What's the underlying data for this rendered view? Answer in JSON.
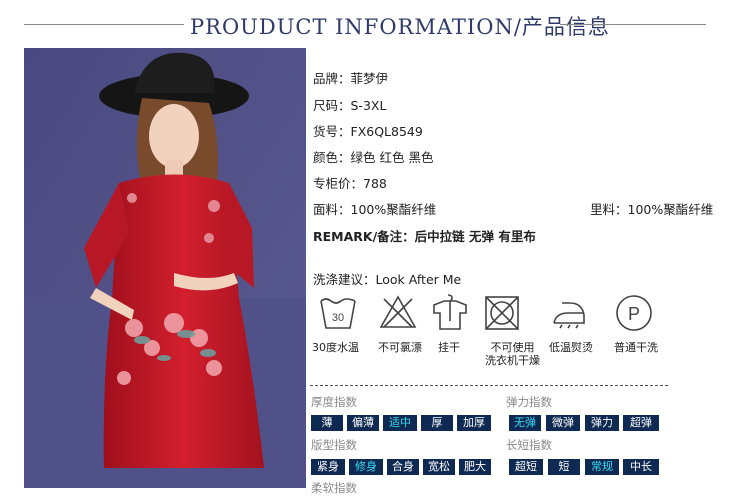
{
  "header": {
    "title": "PROUDUCT  INFORMATION/产品信息"
  },
  "product": {
    "brand": "品牌：菲梦伊",
    "size": "尺码：S-3XL",
    "sku": "货号：FX6QL8549",
    "color": "颜色：绿色  红色  黑色",
    "price": "专柜价：788",
    "fabric": "面料：100%聚酯纤维",
    "lining": "里料：100%聚酯纤维",
    "remark": "REMARK/备注：后中拉链 无弹 有里布"
  },
  "care": {
    "title": "洗涤建议：Look After Me",
    "items": [
      {
        "icon": "wash-30-icon",
        "label": "30度水温"
      },
      {
        "icon": "no-bleach-icon",
        "label": "不可氯漂"
      },
      {
        "icon": "hang-dry-icon",
        "label": "挂干"
      },
      {
        "icon": "no-tumble-dry-icon",
        "label": "不可使用\n洗衣机干燥"
      },
      {
        "icon": "low-iron-icon",
        "label": "低温熨烫"
      },
      {
        "icon": "dry-clean-p-icon",
        "label": "普通干洗"
      }
    ]
  },
  "indices": {
    "thickness": {
      "label": "厚度指数",
      "options": [
        "薄",
        "偏薄",
        "适中",
        "厚",
        "加厚"
      ],
      "selected": "适中"
    },
    "elasticity": {
      "label": "弹力指数",
      "options": [
        "无弹",
        "微弹",
        "弹力",
        "超弹"
      ],
      "selected": "无弹"
    },
    "fit": {
      "label": "版型指数",
      "options": [
        "紧身",
        "修身",
        "合身",
        "宽松",
        "肥大"
      ],
      "selected": "修身"
    },
    "length": {
      "label": "长短指数",
      "options": [
        "超短",
        "短",
        "常规",
        "中长"
      ],
      "selected": "常规"
    },
    "cutoff_label": "柔软指数"
  },
  "colors": {
    "accent": "#2f3a6b",
    "cell_bg": "#0f2a52",
    "cell_selected_text": "#38d9f2"
  }
}
